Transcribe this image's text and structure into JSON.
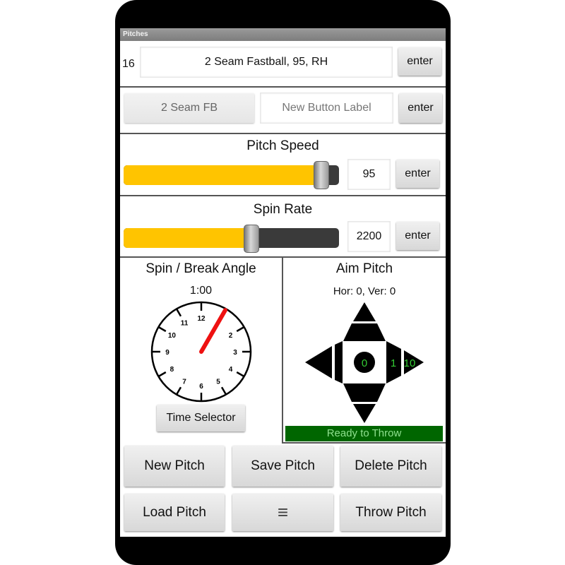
{
  "app": {
    "title": "Pitches"
  },
  "pitch_row": {
    "number": "16",
    "description": "2 Seam Fastball, 95, RH",
    "enter_label": "enter"
  },
  "label_row": {
    "pitch_button_label": "2 Seam FB",
    "new_label_placeholder": "New Button Label",
    "enter_label": "enter"
  },
  "speed": {
    "title": "Pitch Speed",
    "value": "95",
    "fraction": 0.95,
    "enter_label": "enter"
  },
  "spin": {
    "title": "Spin Rate",
    "value": "2200",
    "fraction": 0.6,
    "enter_label": "enter"
  },
  "break_angle": {
    "title": "Spin / Break Angle",
    "time": "1:00",
    "hand_hour": 1,
    "clock_numbers": [
      "12",
      "",
      "2",
      "3",
      "4",
      "5",
      "6",
      "7",
      "8",
      "9",
      "10",
      "11"
    ],
    "time_selector_label": "Time Selector",
    "hand_color": "#ee1111"
  },
  "aim": {
    "title": "Aim Pitch",
    "readout": "Hor: 0, Ver: 0",
    "center_value": "0",
    "right_inner_value": "1",
    "right_outer_value": "10",
    "value_color": "#33cc33",
    "status": "Ready to Throw",
    "status_color": "#006600"
  },
  "actions": {
    "new_pitch": "New Pitch",
    "save_pitch": "Save Pitch",
    "delete_pitch": "Delete Pitch",
    "load_pitch": "Load Pitch",
    "menu_glyph": "≡",
    "throw_pitch": "Throw Pitch"
  }
}
